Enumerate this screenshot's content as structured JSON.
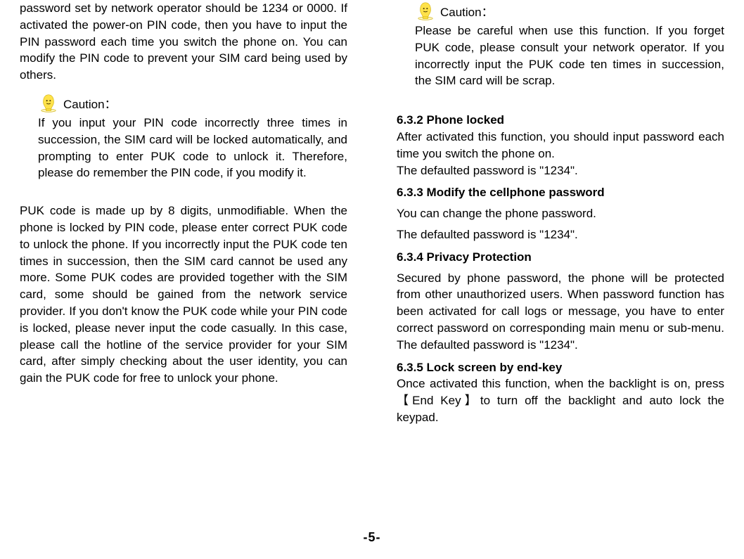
{
  "left": {
    "p1": "password set by network operator should be 1234 or 0000. If activated the power-on PIN code, then you have to input the PIN password each time you switch the phone on. You can modify the PIN code to prevent your SIM card being used by others.",
    "caution_label": "Caution：",
    "caution_text": "If you input your PIN code incorrectly three times in succession, the SIM card will be locked automatically, and prompting to enter PUK code to unlock it. Therefore, please do remember the PIN code, if you modify it.",
    "p2": "PUK code is made up by 8 digits, unmodifiable. When the phone is locked by PIN code, please enter correct PUK code to unlock the phone. If you incorrectly input the PUK code ten times in succession, then the SIM card cannot be used any more. Some PUK codes are provided together with the SIM card, some should be gained from the network service provider. If you don't know the PUK code while your PIN code is locked, please never input the code casually. In this case, please call the hotline of the service provider for your SIM card, after simply checking about the user identity, you can gain the PUK code for free to unlock your phone."
  },
  "right": {
    "caution_label": "Caution：",
    "caution_text": "Please be careful when use this function. If you forget PUK code, please consult your network operator. If you incorrectly input the PUK code ten times in succession, the SIM card will be scrap.",
    "h632": "6.3.2 Phone locked",
    "p632": "After activated this function, you should input password each time you switch the phone on.",
    "p632b": "The defaulted password is \"1234\".",
    "h633": "6.3.3 Modify the cellphone password",
    "p633a": "You can change the phone password.",
    "p633b": "The defaulted password is \"1234\".",
    "h634": "6.3.4 Privacy Protection",
    "p634": "Secured by phone password, the phone will be protected from other unauthorized users. When password function has been activated for call logs or message, you have to enter correct password on corresponding main menu or sub-menu. The defaulted password is \"1234\".",
    "h635": "6.3.5 Lock screen by end-key",
    "p635": "Once activated this function, when the backlight is on, press【End Key】to turn off the backlight and auto lock the keypad."
  },
  "pageNumber": "-5-"
}
